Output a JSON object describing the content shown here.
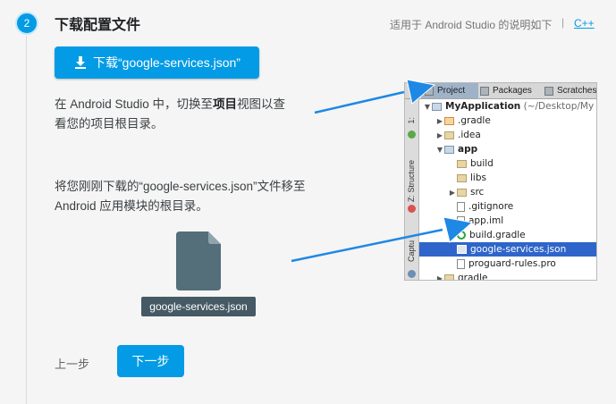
{
  "step": {
    "number": "2",
    "title": "下载配置文件",
    "applies_text": "适用于 Android Studio 的说明如下",
    "separator": "|",
    "cpp_link": "C++"
  },
  "download_button": {
    "label": "下载“google-services.json”",
    "icon": "download-icon"
  },
  "instructions": {
    "p1_before": "在 Android Studio 中，切换至",
    "p1_bold": "项目",
    "p1_after": "视图以查看您的项目根目录。",
    "p2": "将您刚刚下载的“google-services.json”文件移至 Android 应用模块的根目录。"
  },
  "file_card": {
    "label": "google-services.json",
    "icon": "file-icon"
  },
  "nav": {
    "prev_label": "上一步",
    "next_label": "下一步"
  },
  "ide": {
    "tabs": [
      "Project",
      "Packages",
      "Scratches"
    ],
    "side_labels": [
      "1:",
      "Z: Structure",
      "Captu"
    ],
    "tree": [
      {
        "label": "MyApplication",
        "suffix": "(~/Desktop/My",
        "type": "module"
      },
      {
        "label": ".gradle",
        "type": "folder-orange"
      },
      {
        "label": ".idea",
        "type": "folder"
      },
      {
        "label": "app",
        "type": "module"
      },
      {
        "label": "build",
        "type": "folder"
      },
      {
        "label": "libs",
        "type": "folder"
      },
      {
        "label": "src",
        "type": "folder"
      },
      {
        "label": ".gitignore",
        "type": "file"
      },
      {
        "label": "app.iml",
        "type": "file"
      },
      {
        "label": "build.gradle",
        "type": "gradle"
      },
      {
        "label": "google-services.json",
        "type": "json",
        "selected": true
      },
      {
        "label": "proguard-rules.pro",
        "type": "file"
      },
      {
        "label": "gradle",
        "type": "folder"
      }
    ]
  },
  "colors": {
    "accent": "#039be5",
    "selection": "#2f65ca",
    "arrow": "#1e88e5",
    "file_label_bg": "#455a64"
  }
}
